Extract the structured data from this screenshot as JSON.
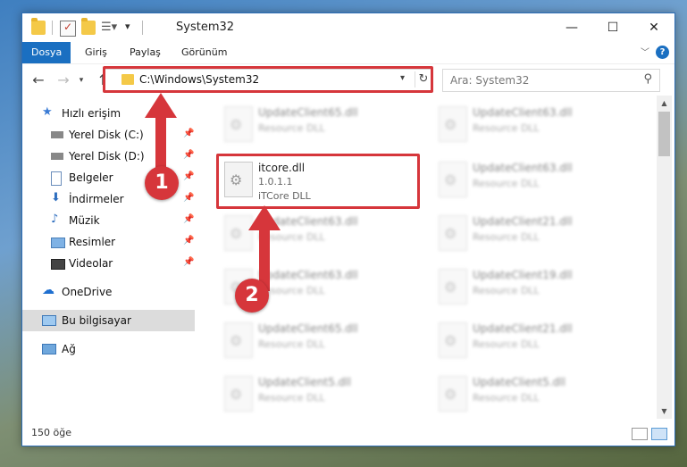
{
  "window": {
    "title": "System32"
  },
  "ribbon": {
    "tabs": [
      "Dosya",
      "Giriş",
      "Paylaş",
      "Görünüm"
    ]
  },
  "address": {
    "path": "C:\\Windows\\System32"
  },
  "search": {
    "placeholder": "Ara: System32"
  },
  "sidebar": {
    "items": [
      {
        "label": "Hızlı erişim",
        "icon": "star-icon"
      },
      {
        "label": "Yerel Disk (C:)",
        "icon": "drive-icon",
        "pinned": true
      },
      {
        "label": "Yerel Disk (D:)",
        "icon": "drive-icon",
        "pinned": true
      },
      {
        "label": "Belgeler",
        "icon": "documents-icon",
        "pinned": true
      },
      {
        "label": "İndirmeler",
        "icon": "download-icon",
        "pinned": true
      },
      {
        "label": "Müzik",
        "icon": "music-icon",
        "pinned": true
      },
      {
        "label": "Resimler",
        "icon": "pictures-icon",
        "pinned": true
      },
      {
        "label": "Videolar",
        "icon": "videos-icon",
        "pinned": true
      },
      {
        "label": "OneDrive",
        "icon": "cloud-icon"
      },
      {
        "label": "Bu bilgisayar",
        "icon": "computer-icon",
        "selected": true
      },
      {
        "label": "Ağ",
        "icon": "network-icon"
      }
    ]
  },
  "files": {
    "highlighted": {
      "name": "itcore.dll",
      "version": "1.0.1.1",
      "description": "iTCore DLL"
    },
    "left_column": [
      {
        "name": "UpdateClient65.dll",
        "type": "Resource DLL"
      },
      {
        "name": "UpdateClient63.dll",
        "type": "Resource DLL"
      },
      {
        "name": "UpdateClient63.dll",
        "type": "Resource DLL"
      },
      {
        "name": "UpdateClient65.dll",
        "type": "Resource DLL"
      },
      {
        "name": "UpdateClient5.dll",
        "type": "Resource DLL"
      }
    ],
    "right_column": [
      {
        "name": "UpdateClient63.dll",
        "type": "Resource DLL"
      },
      {
        "name": "UpdateClient63.dll",
        "type": "Resource DLL"
      },
      {
        "name": "UpdateClient21.dll",
        "type": "Resource DLL"
      },
      {
        "name": "UpdateClient19.dll",
        "type": "Resource DLL"
      },
      {
        "name": "UpdateClient21.dll",
        "type": "Resource DLL"
      },
      {
        "name": "UpdateClient5.dll",
        "type": "Resource DLL"
      }
    ]
  },
  "status": {
    "count": "150 öğe"
  },
  "annotations": {
    "step1": "1",
    "step2": "2",
    "color": "#d6363b"
  }
}
